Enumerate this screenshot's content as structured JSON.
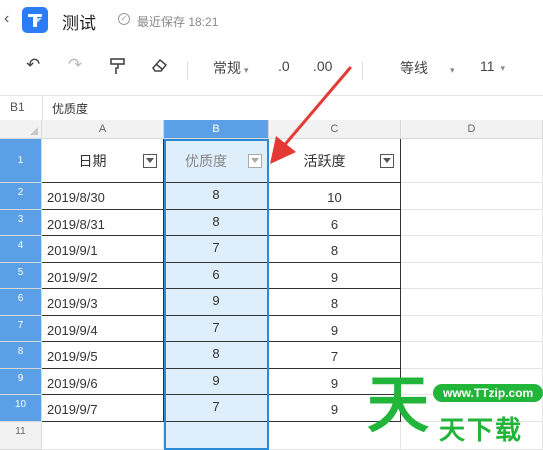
{
  "titlebar": {
    "back_icon": "chevron-left",
    "logo_letter": "T",
    "doc_title": "测试",
    "save_icon": "check-circle",
    "save_status": "最近保存 18:21"
  },
  "toolbar": {
    "undo": "↶",
    "redo": "↷",
    "format_painter": "⌖",
    "eraser": "◆",
    "number_format": "常规",
    "decrease_decimal": ".0",
    "increase_decimal": ".00",
    "font_name": "等线",
    "font_size": "11"
  },
  "formula_bar": {
    "cell_ref": "B1",
    "content": "优质度"
  },
  "columns": [
    "A",
    "B",
    "C",
    "D"
  ],
  "selected_column": "B",
  "row_numbers": [
    "1",
    "2",
    "3",
    "4",
    "5",
    "6",
    "7",
    "8",
    "9",
    "10",
    "11"
  ],
  "headers": {
    "date": "日期",
    "quality": "优质度",
    "activity": "活跃度"
  },
  "rows": [
    {
      "date": "2019/8/30",
      "quality": "8",
      "activity": "10"
    },
    {
      "date": "2019/8/31",
      "quality": "8",
      "activity": "6"
    },
    {
      "date": "2019/9/1",
      "quality": "7",
      "activity": "8"
    },
    {
      "date": "2019/9/2",
      "quality": "6",
      "activity": "9"
    },
    {
      "date": "2019/9/3",
      "quality": "9",
      "activity": "8"
    },
    {
      "date": "2019/9/4",
      "quality": "7",
      "activity": "9"
    },
    {
      "date": "2019/9/5",
      "quality": "8",
      "activity": "7"
    },
    {
      "date": "2019/9/6",
      "quality": "9",
      "activity": "9"
    },
    {
      "date": "2019/9/7",
      "quality": "7",
      "activity": "9"
    }
  ],
  "watermark": {
    "main": "天",
    "url": "www.TTzip.com",
    "sub": "天下载"
  },
  "colors": {
    "selection": "#2b8ad6",
    "header_selected": "#5ba0e6",
    "arrow": "#e53935",
    "watermark": "#21b53a"
  }
}
